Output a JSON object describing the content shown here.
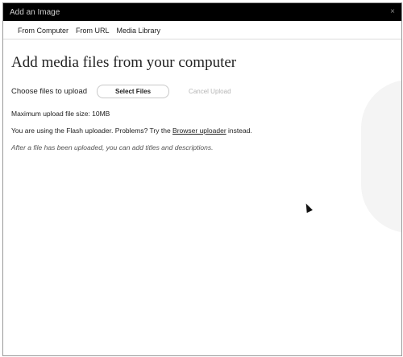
{
  "window": {
    "title": "Add an Image",
    "close_glyph": "×"
  },
  "tabs": [
    {
      "label": "From Computer"
    },
    {
      "label": "From URL"
    },
    {
      "label": "Media Library"
    }
  ],
  "main": {
    "heading": "Add media files from your computer",
    "choose_label": "Choose files to upload",
    "select_button": "Select Files",
    "cancel_button": "Cancel Upload",
    "max_size": "Maximum upload file size: 10MB",
    "flash_text_before": "You are using the Flash uploader. Problems? Try the ",
    "flash_link": "Browser uploader",
    "flash_text_after": " instead.",
    "note": "After a file has been uploaded, you can add titles and descriptions."
  },
  "icons": {
    "close": "close-icon",
    "cursor": "mouse-pointer-icon"
  }
}
